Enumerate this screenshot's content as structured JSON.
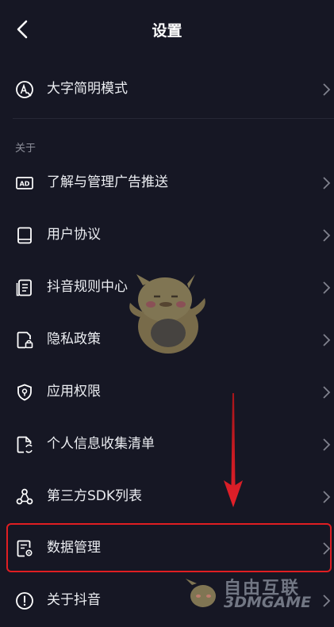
{
  "header": {
    "title": "设置"
  },
  "top_item": {
    "label": "大字简明模式",
    "icon": "font-size-icon"
  },
  "section_about": {
    "title": "关于"
  },
  "items": [
    {
      "label": "了解与管理广告推送",
      "icon": "ad-icon"
    },
    {
      "label": "用户协议",
      "icon": "book-icon"
    },
    {
      "label": "抖音规则中心",
      "icon": "document-list-icon"
    },
    {
      "label": "隐私政策",
      "icon": "privacy-lock-icon"
    },
    {
      "label": "应用权限",
      "icon": "shield-icon"
    },
    {
      "label": "个人信息收集清单",
      "icon": "file-refresh-icon"
    },
    {
      "label": "第三方SDK列表",
      "icon": "nodes-icon"
    },
    {
      "label": "数据管理",
      "icon": "data-settings-icon"
    },
    {
      "label": "关于抖音",
      "icon": "info-icon"
    }
  ],
  "highlighted_item": "数据管理",
  "colors": {
    "background": "#161724",
    "highlight": "#e01e22",
    "text": "#eceef2",
    "section": "#8d8f9a"
  },
  "watermark": {
    "cn": "自由互联",
    "en": "3DMGAME"
  }
}
